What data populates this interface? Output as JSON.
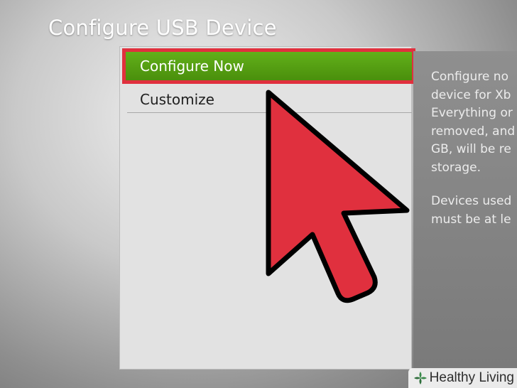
{
  "screen": {
    "title": "Configure USB Device"
  },
  "menu": {
    "items": [
      {
        "label": "Configure Now",
        "selected": true
      },
      {
        "label": "Customize",
        "selected": false
      }
    ]
  },
  "description": {
    "paragraph1": "Configure no\ndevice for Xb\nEverything or\nremoved, and\nGB, will be re\nstorage.",
    "paragraph2": "Devices used\nmust be at le"
  },
  "overlay": {
    "arrow_icon": "cursor-arrow-icon",
    "arrow_color": "#e0303e"
  },
  "watermark": {
    "text": "Healthy Living",
    "logo_icon": "healthy-living-logo-icon"
  },
  "colors": {
    "selection_green": "#55a012",
    "highlight_red": "#e0303e"
  }
}
